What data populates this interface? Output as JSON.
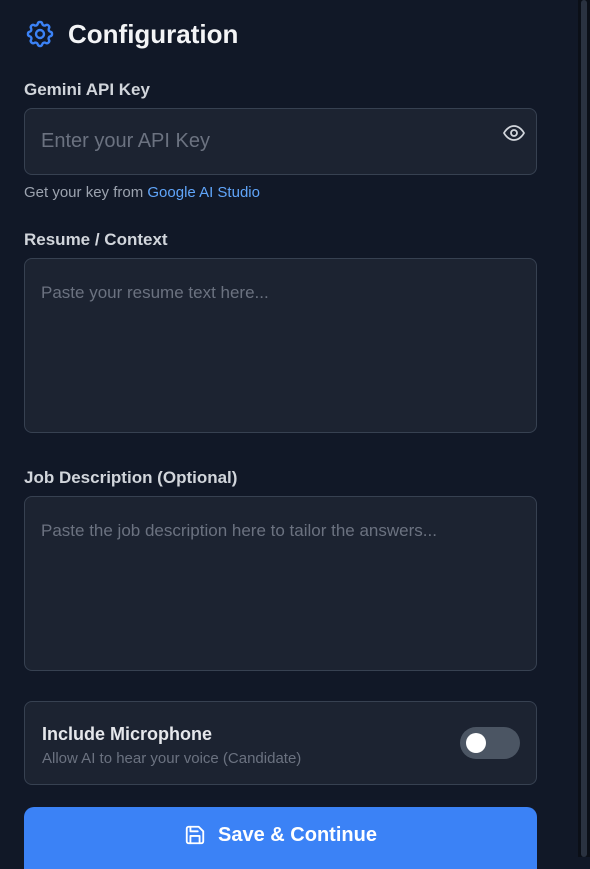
{
  "header": {
    "title": "Configuration",
    "icon": "gear-icon"
  },
  "api_key": {
    "label": "Gemini API Key",
    "placeholder": "Enter your API Key",
    "value": "",
    "hint_prefix": "Get your key from ",
    "hint_link": "Google AI Studio"
  },
  "resume": {
    "label": "Resume / Context",
    "placeholder": "Paste your resume text here...",
    "value": ""
  },
  "job": {
    "label": "Job Description (Optional)",
    "placeholder": "Paste the job description here to tailor the answers...",
    "value": ""
  },
  "microphone": {
    "title": "Include Microphone",
    "subtitle": "Allow AI to hear your voice (Candidate)",
    "enabled": false
  },
  "save": {
    "label": "Save & Continue",
    "icon": "save-icon"
  },
  "colors": {
    "background": "#111827",
    "card": "#1c2331",
    "border": "#374151",
    "accent": "#3b82f6",
    "link": "#60a5fa"
  }
}
